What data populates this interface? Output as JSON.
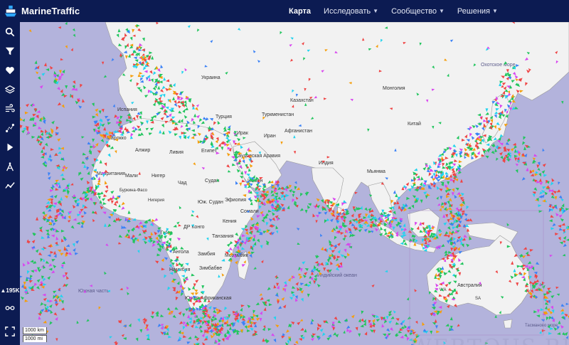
{
  "app": {
    "logo_text": "MarineTraffic"
  },
  "nav": [
    {
      "label": "Карта",
      "active": true,
      "dropdown": false
    },
    {
      "label": "Исследовать",
      "active": false,
      "dropdown": true
    },
    {
      "label": "Сообщество",
      "active": false,
      "dropdown": true
    },
    {
      "label": "Решения",
      "active": false,
      "dropdown": true
    }
  ],
  "sidebar": {
    "tools": [
      "search-icon",
      "filter-icon",
      "heart-icon",
      "layers-icon",
      "wind-icon",
      "measure-icon",
      "play-icon",
      "compass-icon",
      "analytics-icon"
    ],
    "vessel_count": "195K"
  },
  "scale": {
    "km": "1000 km",
    "mi": "1000 mi"
  },
  "watermark": "WEBTOUS.RU",
  "map_labels": {
    "ukraine": "Украина",
    "turkey": "Турция",
    "spain": "Испания",
    "morocco": "Марокко",
    "algeria": "Алжир",
    "libya": "Ливия",
    "egypt": "Египет",
    "mauritania": "Мавритания",
    "mali": "Мали",
    "niger": "Нигер",
    "chad": "Чад",
    "sudan": "Судан",
    "ethiopia": "Эфиопия",
    "south_sudan": "Юж. Судан",
    "drc": "ДР Конго",
    "kenya": "Кения",
    "tanzania": "Танзания",
    "angola": "Ангола",
    "zambia": "Замбия",
    "namibia": "Намибия",
    "zimbabwe": "Зимбабве",
    "mozambique": "Мозамбик",
    "south_africa": "Южно-Африканская",
    "iraq": "Ирак",
    "iran": "Иран",
    "saudi": "Саудовская Аравия",
    "yemen": "Йемен",
    "somalia": "Сомали",
    "afghanistan": "Афганистан",
    "turkmenistan": "Туркменистан",
    "kazakhstan": "Казахстан",
    "mongolia": "Монголия",
    "china": "Китай",
    "india": "Индия",
    "myanmar": "Мьянма",
    "indian_ocean": "Индийский океан",
    "south_atlantic": "Южная часть",
    "australia": "Австралия",
    "okhotsk": "Охотское море",
    "wa": "WA",
    "sa": "SA",
    "tasman": "Тасманово море",
    "nigeria": "Нигерия",
    "burkina": "Буркина-Фасо",
    "gabon": "Габон"
  }
}
